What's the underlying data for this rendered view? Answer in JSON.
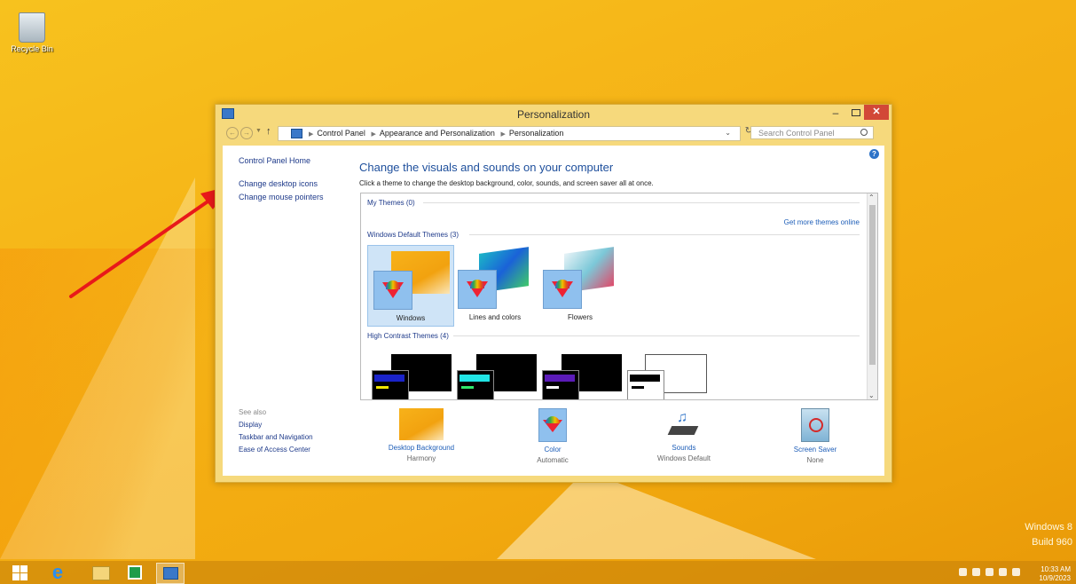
{
  "desktop": {
    "recycle_bin_label": "Recycle Bin",
    "watermark_line1": "Windows 8",
    "watermark_line2": "Build 960"
  },
  "window": {
    "title": "Personalization",
    "minimize": "–",
    "close": "✕",
    "breadcrumbs": [
      "Control Panel",
      "Appearance and Personalization",
      "Personalization"
    ],
    "search_placeholder": "Search Control Panel",
    "help": "?"
  },
  "left_pane": {
    "home": "Control Panel Home",
    "links": [
      "Change desktop icons",
      "Change mouse pointers"
    ]
  },
  "main": {
    "heading": "Change the visuals and sounds on your computer",
    "subheading": "Click a theme to change the desktop background, color, sounds, and screen saver all at once.",
    "my_themes": "My Themes (0)",
    "get_more": "Get more themes online",
    "default_group": "Windows Default Themes (3)",
    "default_themes": [
      "Windows",
      "Lines and colors",
      "Flowers"
    ],
    "hc_group": "High Contrast Themes (4)"
  },
  "see_also": {
    "header": "See also",
    "links": [
      "Display",
      "Taskbar and Navigation",
      "Ease of Access Center"
    ]
  },
  "bottom": [
    {
      "name": "Desktop Background",
      "value": "Harmony"
    },
    {
      "name": "Color",
      "value": "Automatic"
    },
    {
      "name": "Sounds",
      "value": "Windows Default"
    },
    {
      "name": "Screen Saver",
      "value": "None"
    }
  ],
  "taskbar": {
    "time": "10:33 AM",
    "date": "10/9/2023"
  },
  "colors": {
    "accent_link": "#1e3a8a",
    "close_red": "#d24837",
    "window_frame": "#f6d97c",
    "arrow": "#e8191a"
  }
}
